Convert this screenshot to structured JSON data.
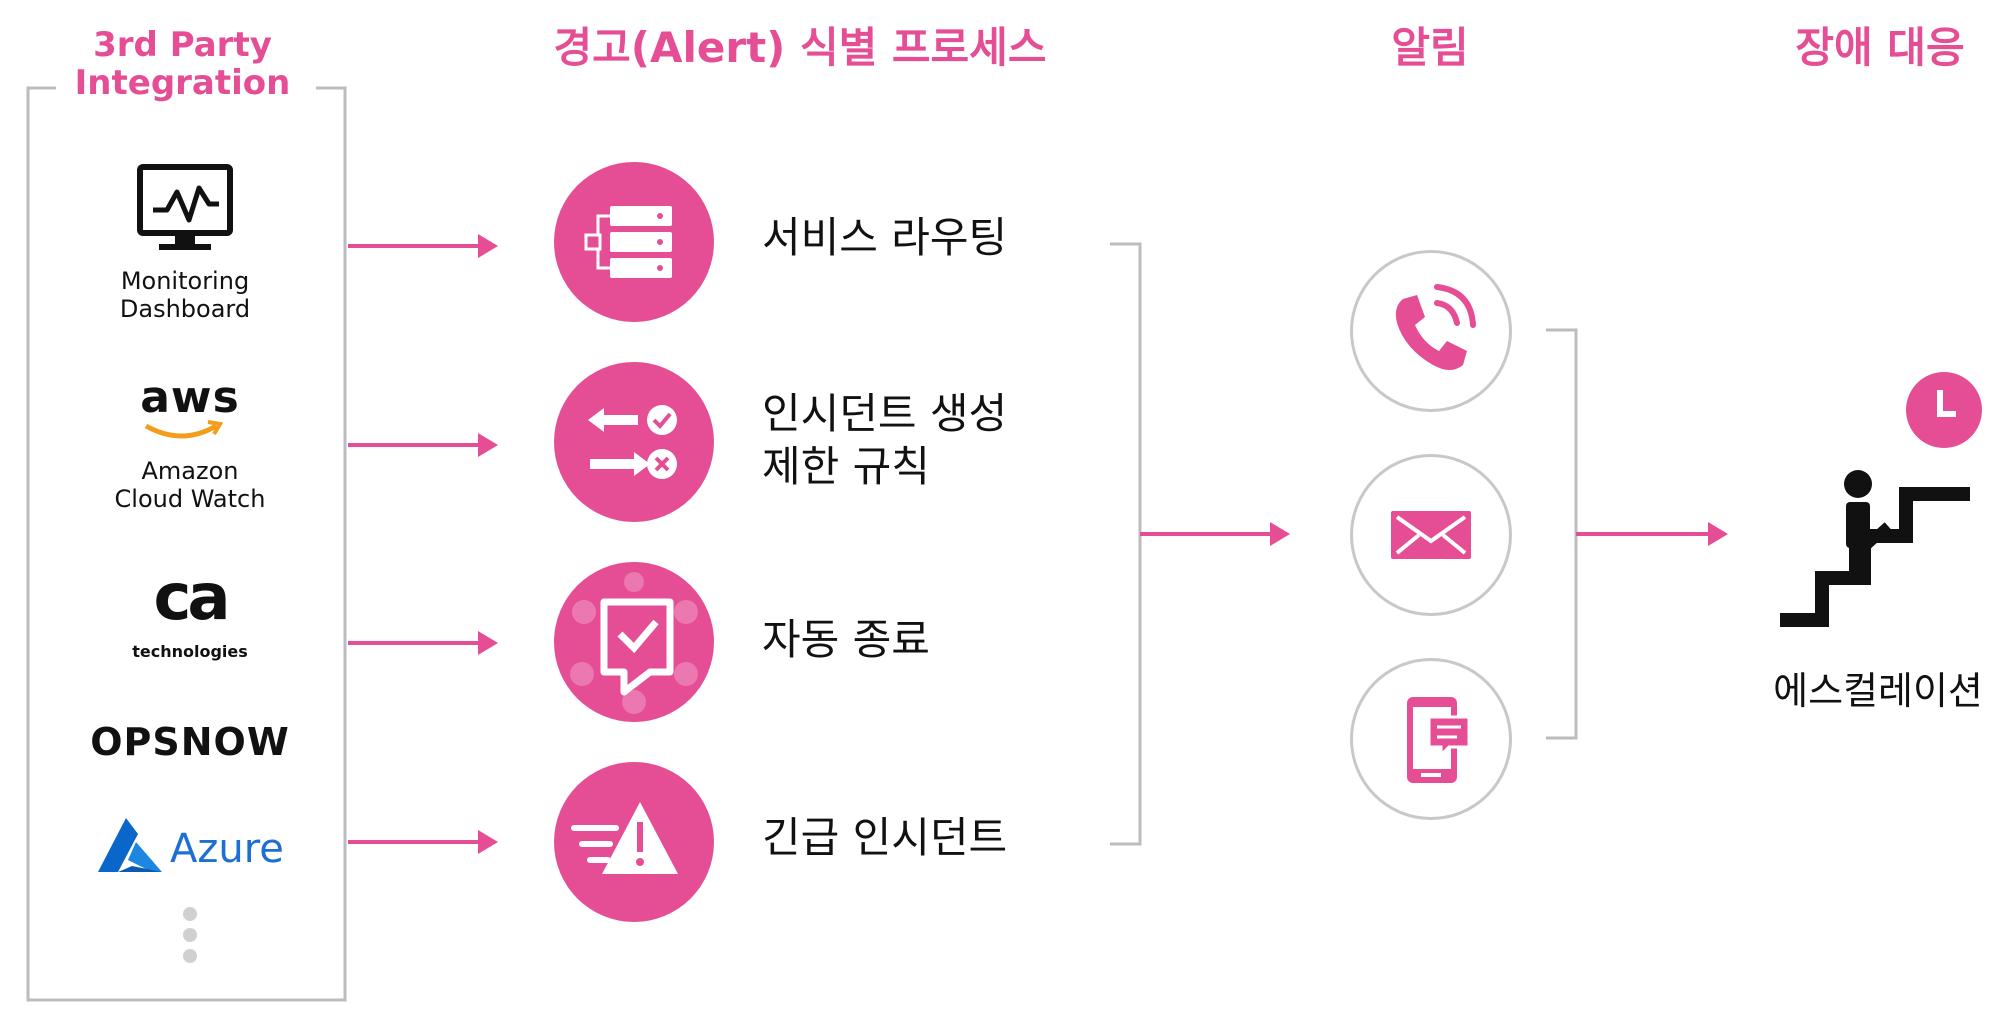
{
  "headers": {
    "integration": "3rd Party\nIntegration",
    "process": "경고(Alert) 식별 프로세스",
    "notification": "알림",
    "response": "장애 대응"
  },
  "sources": [
    {
      "icon": "monitor-chart-icon",
      "label": "Monitoring\nDashboard"
    },
    {
      "icon": "aws-logo",
      "logo_text": "aws",
      "label": "Amazon\nCloud Watch"
    },
    {
      "icon": "ca-technologies-logo",
      "logo_text": "ca",
      "label": "technologies"
    },
    {
      "icon": "opsnow-logo",
      "logo_text": "OPSNOW"
    },
    {
      "icon": "azure-logo",
      "logo_text": "Azure"
    }
  ],
  "processes": [
    {
      "icon": "server-routing-icon",
      "label": "서비스 라우팅"
    },
    {
      "icon": "arrows-check-x-icon",
      "label": "인시던트 생성\n제한 규칙"
    },
    {
      "icon": "auto-close-check-icon",
      "label": "자동 종료"
    },
    {
      "icon": "urgent-warning-icon",
      "label": "긴급 인시던트"
    }
  ],
  "notifications": [
    "phone-call-icon",
    "envelope-icon",
    "mobile-message-icon"
  ],
  "escalation": {
    "icon": "stairs-climb-icon",
    "clock_icon": "clock-icon",
    "label": "에스컬레이션"
  },
  "colors": {
    "accent": "#e54e95",
    "bracket": "#bdbdbd",
    "text": "#111111"
  }
}
